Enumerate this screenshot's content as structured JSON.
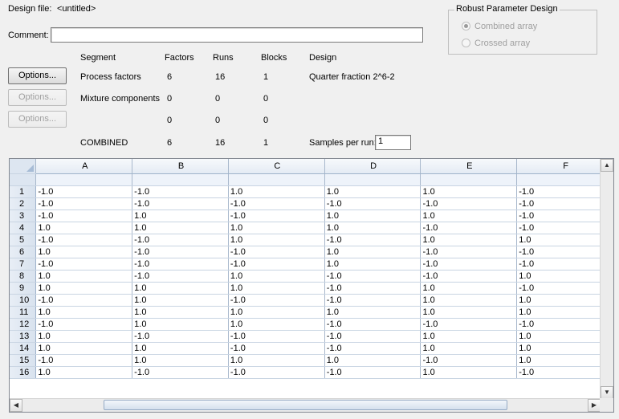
{
  "design_file": {
    "label": "Design file:",
    "value": "<untitled>"
  },
  "comment": {
    "label": "Comment:",
    "value": ""
  },
  "robust": {
    "title": "Robust Parameter Design",
    "options": [
      {
        "label": "Combined array",
        "selected": true
      },
      {
        "label": "Crossed array",
        "selected": false
      }
    ]
  },
  "segments": {
    "headers": [
      "Segment",
      "Factors",
      "Runs",
      "Blocks",
      "Design"
    ],
    "rows": [
      {
        "button": "Options...",
        "enabled": true,
        "segment": "Process factors",
        "factors": "6",
        "runs": "16",
        "blocks": "1",
        "design": "Quarter fraction 2^6-2"
      },
      {
        "button": "Options...",
        "enabled": false,
        "segment": "Mixture components",
        "factors": "0",
        "runs": "0",
        "blocks": "0",
        "design": ""
      },
      {
        "button": "Options...",
        "enabled": false,
        "segment": "",
        "factors": "0",
        "runs": "0",
        "blocks": "0",
        "design": ""
      }
    ],
    "combined": {
      "segment": "COMBINED",
      "factors": "6",
      "runs": "16",
      "blocks": "1"
    },
    "samples_label": "Samples per run:",
    "samples_value": "1"
  },
  "grid": {
    "columns": [
      "A",
      "B",
      "C",
      "D",
      "E",
      "F"
    ],
    "rows": [
      [
        "1",
        "-1.0",
        "-1.0",
        "1.0",
        "1.0",
        "1.0",
        "-1.0"
      ],
      [
        "2",
        "-1.0",
        "-1.0",
        "-1.0",
        "-1.0",
        "-1.0",
        "-1.0"
      ],
      [
        "3",
        "-1.0",
        "1.0",
        "-1.0",
        "1.0",
        "1.0",
        "-1.0"
      ],
      [
        "4",
        "1.0",
        "1.0",
        "1.0",
        "1.0",
        "-1.0",
        "-1.0"
      ],
      [
        "5",
        "-1.0",
        "-1.0",
        "1.0",
        "-1.0",
        "1.0",
        "1.0"
      ],
      [
        "6",
        "1.0",
        "-1.0",
        "-1.0",
        "1.0",
        "-1.0",
        "-1.0"
      ],
      [
        "7",
        "-1.0",
        "-1.0",
        "-1.0",
        "1.0",
        "-1.0",
        "-1.0"
      ],
      [
        "8",
        "1.0",
        "-1.0",
        "1.0",
        "-1.0",
        "-1.0",
        "1.0"
      ],
      [
        "9",
        "1.0",
        "1.0",
        "1.0",
        "-1.0",
        "1.0",
        "-1.0"
      ],
      [
        "10",
        "-1.0",
        "1.0",
        "-1.0",
        "-1.0",
        "1.0",
        "1.0"
      ],
      [
        "11",
        "1.0",
        "1.0",
        "1.0",
        "1.0",
        "1.0",
        "1.0"
      ],
      [
        "12",
        "-1.0",
        "1.0",
        "1.0",
        "-1.0",
        "-1.0",
        "-1.0"
      ],
      [
        "13",
        "1.0",
        "-1.0",
        "-1.0",
        "-1.0",
        "1.0",
        "1.0"
      ],
      [
        "14",
        "1.0",
        "1.0",
        "-1.0",
        "-1.0",
        "1.0",
        "1.0"
      ],
      [
        "15",
        "-1.0",
        "1.0",
        "1.0",
        "1.0",
        "-1.0",
        "1.0"
      ],
      [
        "16",
        "1.0",
        "-1.0",
        "-1.0",
        "-1.0",
        "1.0",
        "-1.0"
      ]
    ]
  },
  "icons": {
    "scroll_up": "arrow-up-icon",
    "scroll_down": "arrow-down-icon",
    "scroll_left": "arrow-left-icon",
    "scroll_right": "arrow-right-icon"
  }
}
